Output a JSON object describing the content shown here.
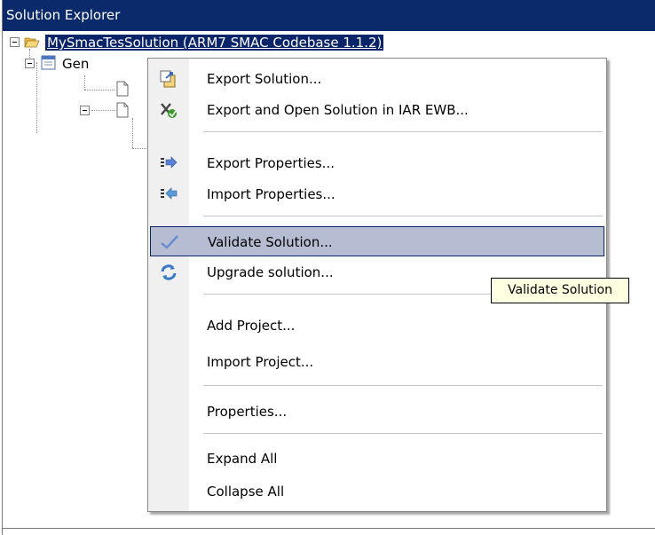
{
  "panel": {
    "title": "Solution Explorer"
  },
  "tree": {
    "root_label": "MySmacTesSolution (ARM7 SMAC Codebase 1.1.2)",
    "child_label": "Gen"
  },
  "menu": {
    "items": [
      {
        "label": "Export Solution...",
        "icon": "export-solution-icon"
      },
      {
        "label": "Export and Open Solution in IAR EWB...",
        "icon": "export-open-iar-icon"
      },
      {
        "label": "Export Properties...",
        "icon": "export-properties-icon"
      },
      {
        "label": "Import Properties...",
        "icon": "import-properties-icon"
      },
      {
        "label": "Validate Solution...",
        "icon": "checkmark-icon"
      },
      {
        "label": "Upgrade solution...",
        "icon": "refresh-icon"
      },
      {
        "label": "Add Project...",
        "icon": ""
      },
      {
        "label": "Import Project...",
        "icon": ""
      },
      {
        "label": "Properties...",
        "icon": ""
      },
      {
        "label": "Expand All",
        "icon": ""
      },
      {
        "label": "Collapse All",
        "icon": ""
      }
    ],
    "highlighted_index": 4
  },
  "tooltip": {
    "text": "Validate Solution"
  },
  "colors": {
    "titlebar": "#0a2a6b",
    "selection": "#0a246a",
    "menu_highlight": "#b6bdd2",
    "tooltip_bg": "#ffffe1"
  }
}
